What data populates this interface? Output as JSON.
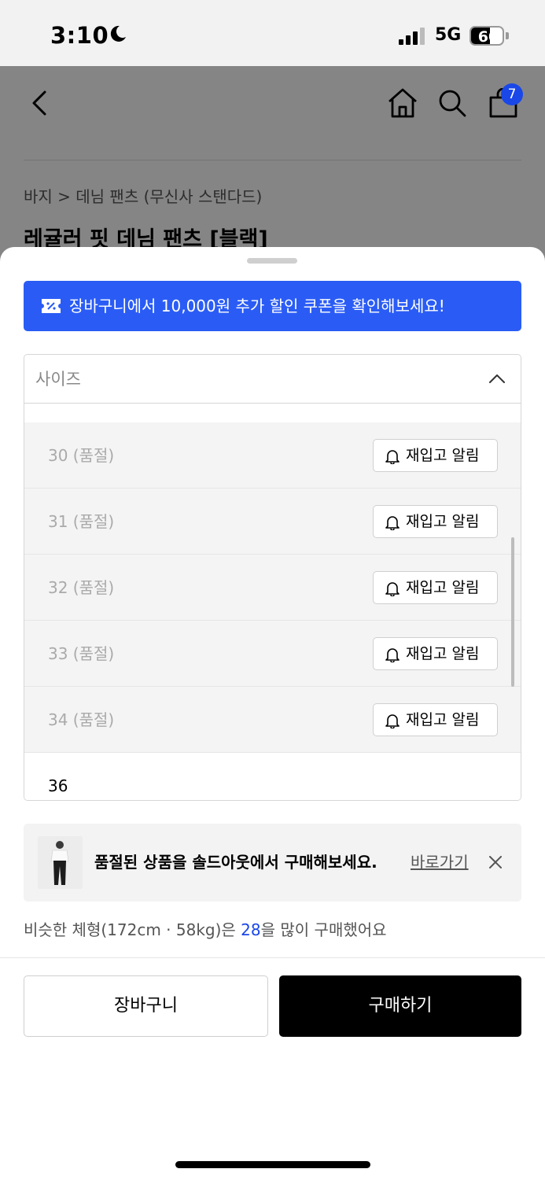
{
  "status_bar": {
    "time": "3:10",
    "network": "5G",
    "battery": "60",
    "battery_level": 0.6
  },
  "nav": {
    "cart_count": "7"
  },
  "product": {
    "breadcrumb": "바지 > 데님 팬츠 (무신사 스탠다드)",
    "title": "레귤러 핏 데님 팬츠 [블랙]"
  },
  "sheet": {
    "coupon_text": "장바구니에서 10,000원 추가 할인 쿠폰을 확인해보세요!",
    "size_label": "사이즈",
    "sizes": [
      {
        "name": "30 (품절)",
        "action": "재입고 알림"
      },
      {
        "name": "31 (품절)",
        "action": "재입고 알림"
      },
      {
        "name": "32 (품절)",
        "action": "재입고 알림"
      },
      {
        "name": "33 (품절)",
        "action": "재입고 알림"
      },
      {
        "name": "34 (품절)",
        "action": "재입고 알림"
      }
    ],
    "available_size": "36",
    "soldout_banner": {
      "text": "품절된 상품을 솔드아웃에서 구매해보세요.",
      "link": "바로가기"
    },
    "similar": {
      "prefix": "비슷한 체형(172cm · 58kg)은 ",
      "size": "28",
      "suffix": "을 많이 구매했어요"
    },
    "cart_button": "장바구니",
    "buy_button": "구매하기"
  },
  "colors": {
    "accent": "#2a5cf5",
    "badge": "#1a47e8"
  }
}
